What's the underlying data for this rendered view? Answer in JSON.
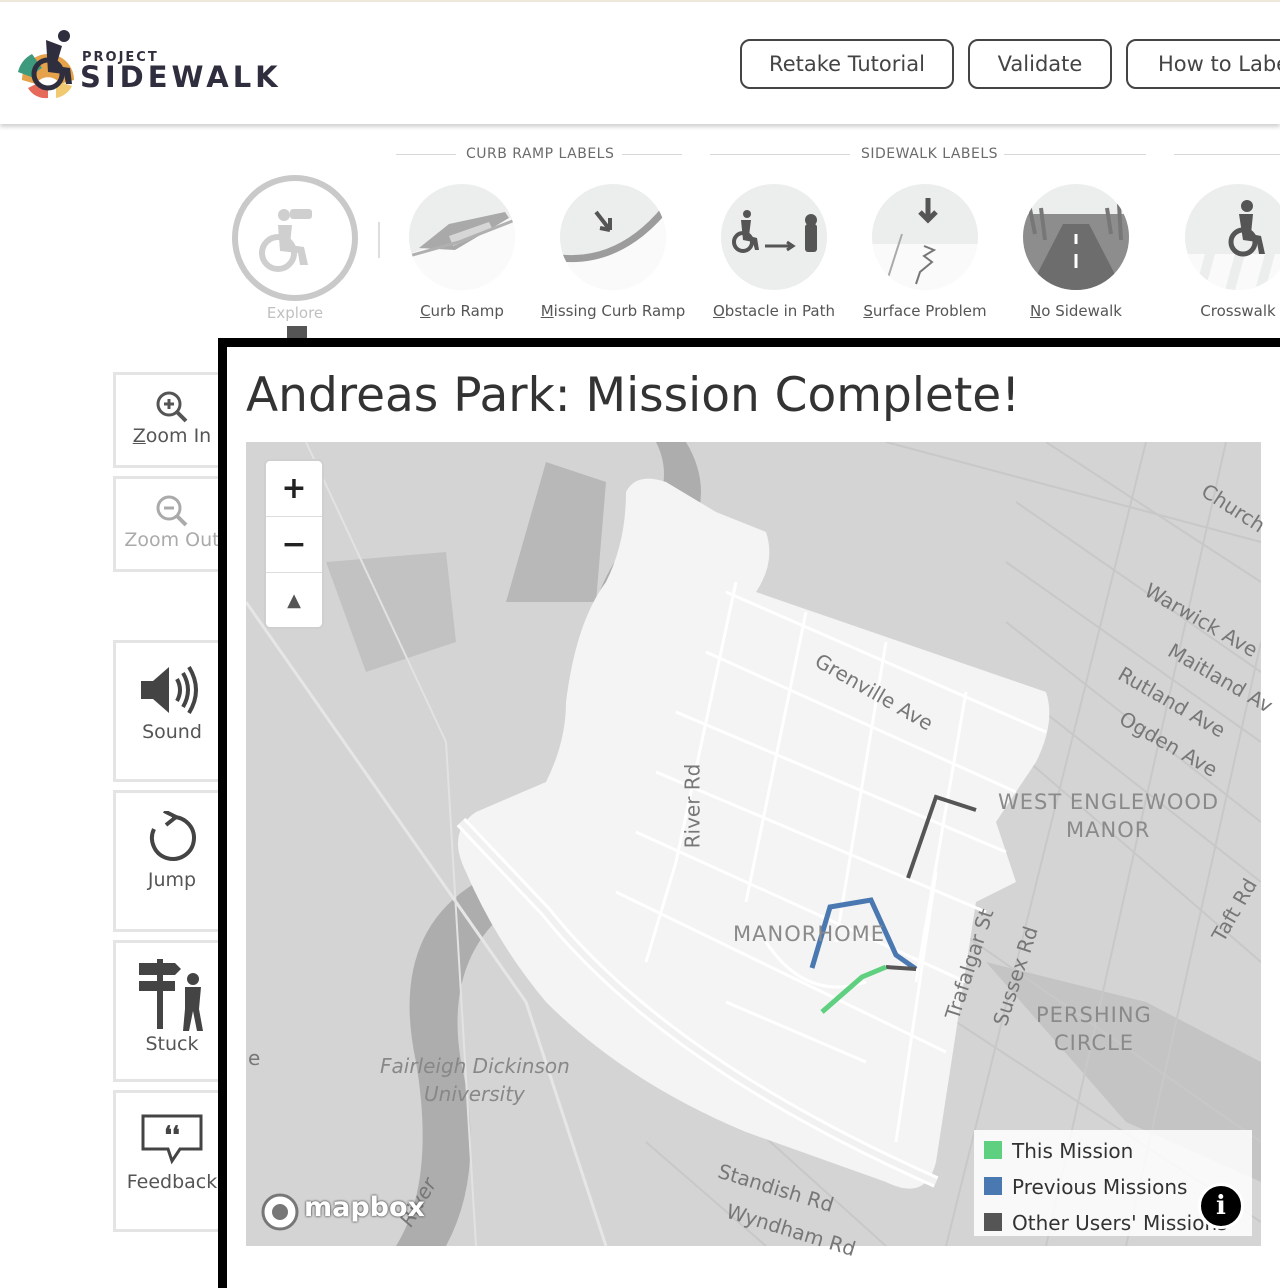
{
  "header": {
    "logo_top": "PROJECT",
    "logo_main": "SIDEWALK",
    "buttons": {
      "retake_tutorial": "Retake Tutorial",
      "validate": "Validate",
      "how_to_label": "How to Label"
    }
  },
  "toolbar": {
    "sections": {
      "curb_ramp": "CURB RAMP LABELS",
      "sidewalk": "SIDEWALK LABELS"
    },
    "explore": "Explore",
    "tools": [
      {
        "key": "C",
        "rest": "urb Ramp"
      },
      {
        "key": "M",
        "rest": "issing Curb Ramp"
      },
      {
        "key": "O",
        "rest": "bstacle in Path"
      },
      {
        "key": "S",
        "rest": "urface Problem"
      },
      {
        "key": "N",
        "rest": "o Sidewalk"
      },
      {
        "key": "",
        "rest": "Crosswalk"
      }
    ]
  },
  "side_tools": {
    "zoom_in": {
      "key": "Z",
      "rest": "oom In"
    },
    "zoom_out": "Zoom Out",
    "sound": "Sound",
    "jump": "Jump",
    "stuck": "Stuck",
    "feedback": "Feedback"
  },
  "modal": {
    "title": "Andreas Park: Mission Complete!",
    "map": {
      "zoom_in": "+",
      "zoom_out": "−",
      "compass": "▲",
      "labels": {
        "church": "Church",
        "warwick": "Warwick Ave",
        "maitland": "Maitland Av",
        "rutland": "Rutland Ave",
        "ogden": "Ogden Ave",
        "grenville": "Grenville Ave",
        "river_rd": "River Rd",
        "west_englewood_1": "WEST ENGLEWOOD",
        "west_englewood_2": "MANOR",
        "manor_home": "MANORHOME",
        "trafalgar": "Trafalgar St",
        "sussex": "Sussex Rd",
        "taft": "Taft Rd",
        "pershing_1": "PERSHING",
        "pershing_2": "CIRCLE",
        "fdu_1": "Fairleigh Dickinson",
        "fdu_2": "University",
        "standish": "Standish Rd",
        "wyndham": "Wyndham Rd",
        "river_label": "River",
        "edge_e": "e",
        "mapbox": "mapbox"
      },
      "legend": [
        {
          "label": "This Mission",
          "color": "#5fd07f"
        },
        {
          "label": "Previous Missions",
          "color": "#4a78b0"
        },
        {
          "label": "Other Users' Missions",
          "color": "#555555"
        }
      ],
      "info": "i"
    }
  }
}
